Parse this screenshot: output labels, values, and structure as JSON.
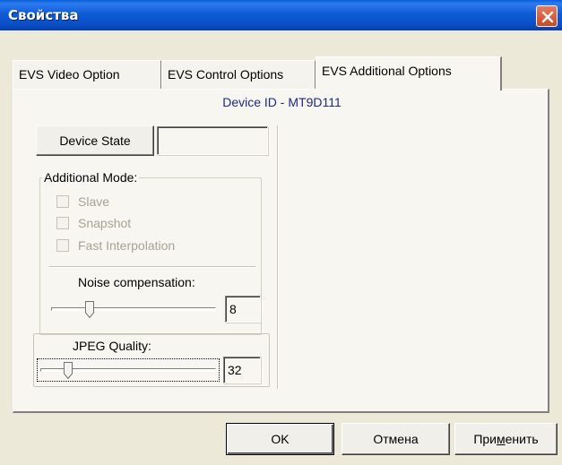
{
  "window": {
    "title": "Свойства",
    "close_icon": "close-icon"
  },
  "tabs": [
    {
      "label": "EVS Video Option",
      "active": false
    },
    {
      "label": "EVS Control Options",
      "active": false
    },
    {
      "label": "EVS Additional Options",
      "active": true
    }
  ],
  "panel": {
    "device_id": "Device ID - MT9D111",
    "device_state_button": "Device State",
    "device_state_value": "",
    "additional_mode": {
      "label": "Additional Mode:",
      "options": [
        {
          "label": "Slave",
          "checked": false,
          "enabled": false
        },
        {
          "label": "Snapshot",
          "checked": false,
          "enabled": false
        },
        {
          "label": "Fast Interpolation",
          "checked": false,
          "enabled": false
        }
      ]
    },
    "noise_compensation": {
      "label": "Noise compensation:",
      "value": "8",
      "level_fraction": 0.2
    },
    "jpeg_quality": {
      "label": "JPEG Quality:",
      "value": "32",
      "level_fraction": 0.15
    }
  },
  "buttons": {
    "ok": "OK",
    "cancel": "Отмена",
    "apply_prefix": "При",
    "apply_underlined": "м",
    "apply_suffix": "енить"
  },
  "colors": {
    "titlebar": "#0a4fc7",
    "close_button": "#d1451e",
    "device_id_text": "#1b2a8c",
    "dialog_bg": "#ece9d8"
  }
}
